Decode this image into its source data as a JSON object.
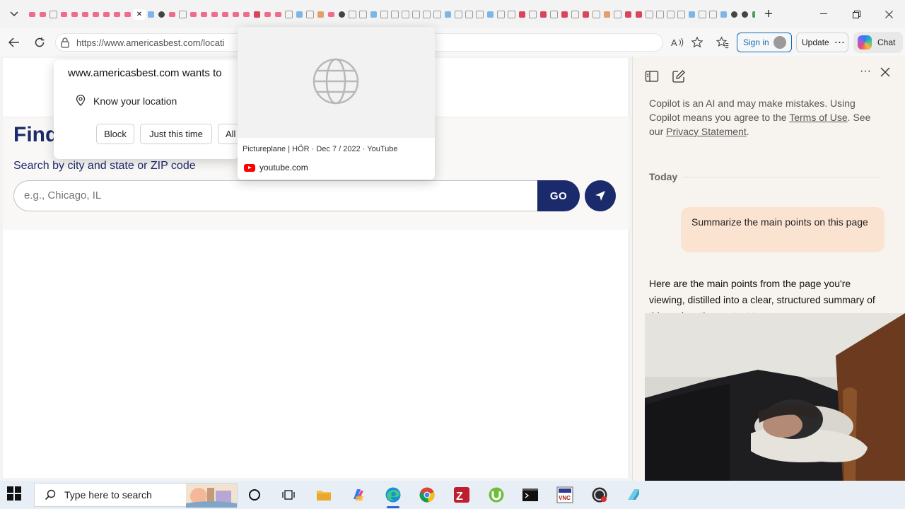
{
  "browser": {
    "url": "https://www.americasbest.com/locati",
    "sign_in": "Sign in",
    "update": "Update",
    "chat": "Chat"
  },
  "hover_card": {
    "meta": "Pictureplane | HÖR · Dec 7 / 2022 · YouTube",
    "site": "youtube.com"
  },
  "permission": {
    "title": "www.americasbest.com wants to",
    "item": "Know your location",
    "block": "Block",
    "just_this_time": "Just this time",
    "allow": "All"
  },
  "page": {
    "title": "Find",
    "search_label": "Search by city and state or ZIP code",
    "search_placeholder": "e.g., Chicago, IL",
    "go": "GO"
  },
  "copilot": {
    "disclaimer_1": "Copilot is an AI and may make mistakes. Using Copilot means you agree to the ",
    "terms": "Terms of Use",
    "disclaimer_2": ". See our ",
    "privacy": "Privacy Statement",
    "disclaimer_3": ".",
    "today": "Today",
    "user_message": "Summarize the main points on this page",
    "answer": "Here are the main points from the page you're viewing, distilled into a clear, structured summary of this and on the content t..."
  },
  "taskbar": {
    "search_placeholder": "Type here to search"
  },
  "colors": {
    "brand_navy": "#1b2a6b",
    "user_bubble": "#fbe3d2",
    "edge_blue": "#0f6cbd"
  }
}
